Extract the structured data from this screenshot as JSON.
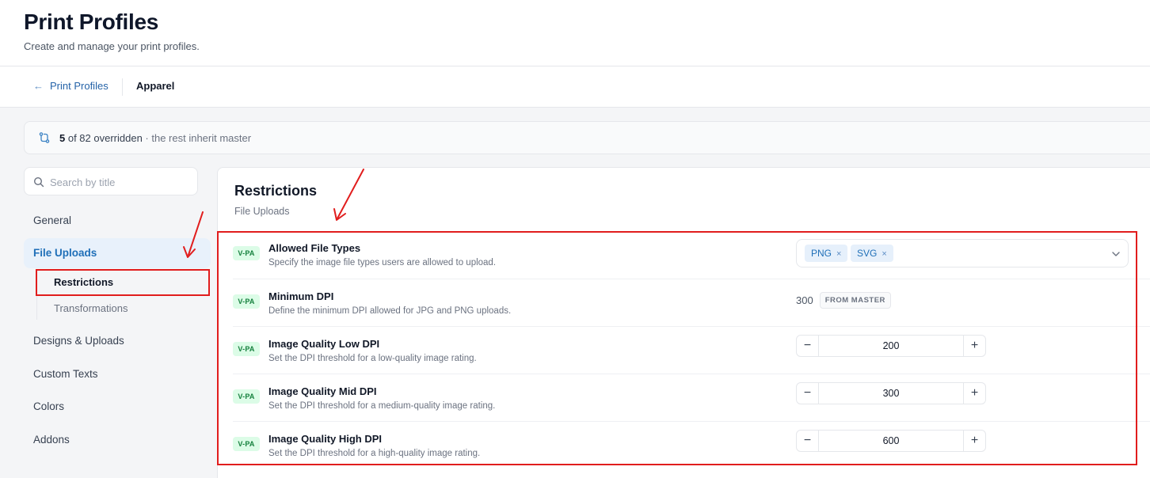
{
  "header": {
    "title": "Print Profiles",
    "subtitle": "Create and manage your print profiles."
  },
  "breadcrumb": {
    "back_label": "Print Profiles",
    "current": "Apparel"
  },
  "banner": {
    "count": "5",
    "middle": " of 82 overridden",
    "rest": " · the rest inherit master"
  },
  "search": {
    "placeholder": "Search by title"
  },
  "sidebar": {
    "items": [
      {
        "label": "General"
      },
      {
        "label": "File Uploads"
      },
      {
        "label": "Designs & Uploads"
      },
      {
        "label": "Custom Texts"
      },
      {
        "label": "Colors"
      },
      {
        "label": "Addons"
      }
    ],
    "subitems": [
      {
        "label": "Restrictions"
      },
      {
        "label": "Transformations"
      }
    ]
  },
  "section": {
    "title": "Restrictions",
    "subtitle": "File Uploads"
  },
  "settings": [
    {
      "badge": "V-PA",
      "title": "Allowed File Types",
      "desc": "Specify the image file types users are allowed to upload.",
      "chips": [
        "PNG",
        "SVG"
      ]
    },
    {
      "badge": "V-PA",
      "title": "Minimum DPI",
      "desc": "Define the minimum DPI allowed for JPG and PNG uploads.",
      "value": "300",
      "tag": "FROM MASTER"
    },
    {
      "badge": "V-PA",
      "title": "Image Quality Low DPI",
      "desc": "Set the DPI threshold for a low-quality image rating.",
      "value": "200"
    },
    {
      "badge": "V-PA",
      "title": "Image Quality Mid DPI",
      "desc": "Set the DPI threshold for a medium-quality image rating.",
      "value": "300"
    },
    {
      "badge": "V-PA",
      "title": "Image Quality High DPI",
      "desc": "Set the DPI threshold for a high-quality image rating.",
      "value": "600"
    }
  ],
  "stepper": {
    "minus": "−",
    "plus": "+"
  },
  "chip_remove": "×",
  "colors": {
    "accent": "#1f6fb8",
    "badge_bg": "#dcfce7",
    "badge_fg": "#15803d",
    "annotation": "#e11d1d"
  }
}
